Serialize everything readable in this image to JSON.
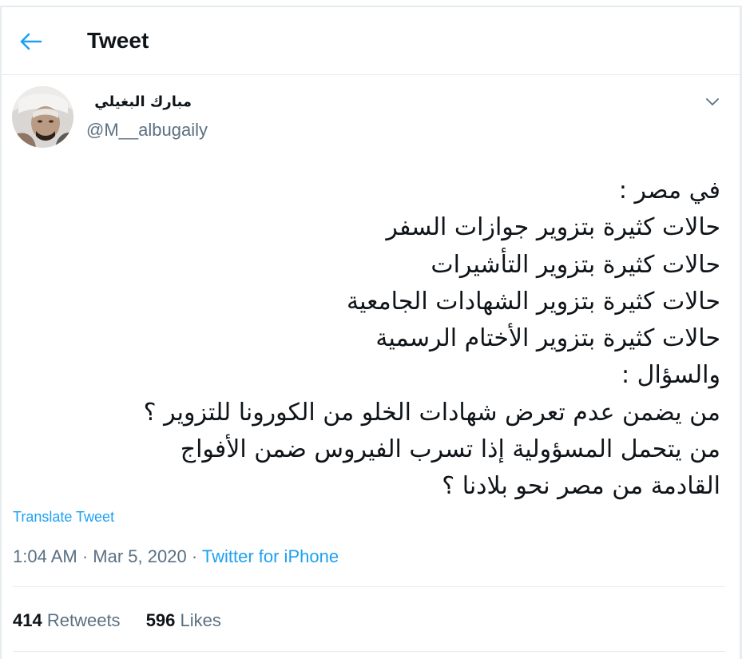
{
  "header": {
    "title": "Tweet",
    "back_icon": "arrow-left-icon",
    "accent": "#1da1f2"
  },
  "author": {
    "name": "مبارك البغيلي",
    "handle": "@M__albugaily",
    "menu_icon": "chevron-down-icon"
  },
  "tweet": {
    "lines": [
      "في مصر :",
      "حالات كثيرة بتزوير جوازات السفر",
      "حالات كثيرة بتزوير التأشيرات",
      "حالات كثيرة بتزوير الشهادات الجامعية",
      "حالات كثيرة بتزوير الأختام الرسمية",
      "والسؤال :",
      "من يضمن عدم تعرض شهادات الخلو من الكورونا للتزوير ؟",
      "من يتحمل المسؤولية إذا تسرب الفيروس ضمن الأفواج",
      "القادمة من مصر نحو بلادنا ؟"
    ],
    "translate_label": "Translate Tweet"
  },
  "meta": {
    "time": "1:04 AM",
    "separator": "·",
    "date": "Mar 5, 2020",
    "source": "Twitter for iPhone"
  },
  "stats": {
    "retweets_count": "414",
    "retweets_label": "Retweets",
    "likes_count": "596",
    "likes_label": "Likes"
  }
}
